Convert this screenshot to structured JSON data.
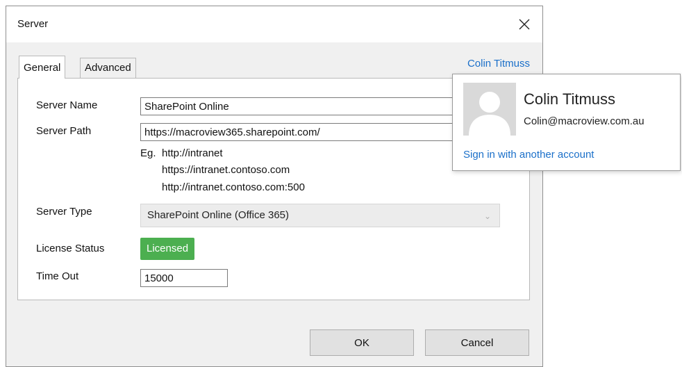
{
  "window": {
    "title": "Server"
  },
  "tabs": [
    "General",
    "Advanced"
  ],
  "account": {
    "link_label": "Colin Titmuss",
    "popup": {
      "name": "Colin Titmuss",
      "email": "Colin@macroview.com.au",
      "switch_label": "Sign in with another account",
      "avatar_icon": "user-silhouette-icon"
    }
  },
  "form": {
    "server_name": {
      "label": "Server Name",
      "value": "SharePoint Online"
    },
    "server_path": {
      "label": "Server Path",
      "value": "https://macroview365.sharepoint.com/",
      "example_prefix": "Eg.",
      "examples": [
        "http://intranet",
        "https://intranet.contoso.com",
        "http://intranet.contoso.com:500"
      ]
    },
    "server_type": {
      "label": "Server Type",
      "value": "SharePoint Online (Office 365)"
    },
    "license_status": {
      "label": "License Status",
      "value": "Licensed",
      "color": "#4caf50"
    },
    "time_out": {
      "label": "Time Out",
      "value": "15000"
    }
  },
  "buttons": {
    "ok": "OK",
    "cancel": "Cancel"
  },
  "colors": {
    "link": "#1a6fc9",
    "dialog_bg": "#f0f0f0"
  }
}
